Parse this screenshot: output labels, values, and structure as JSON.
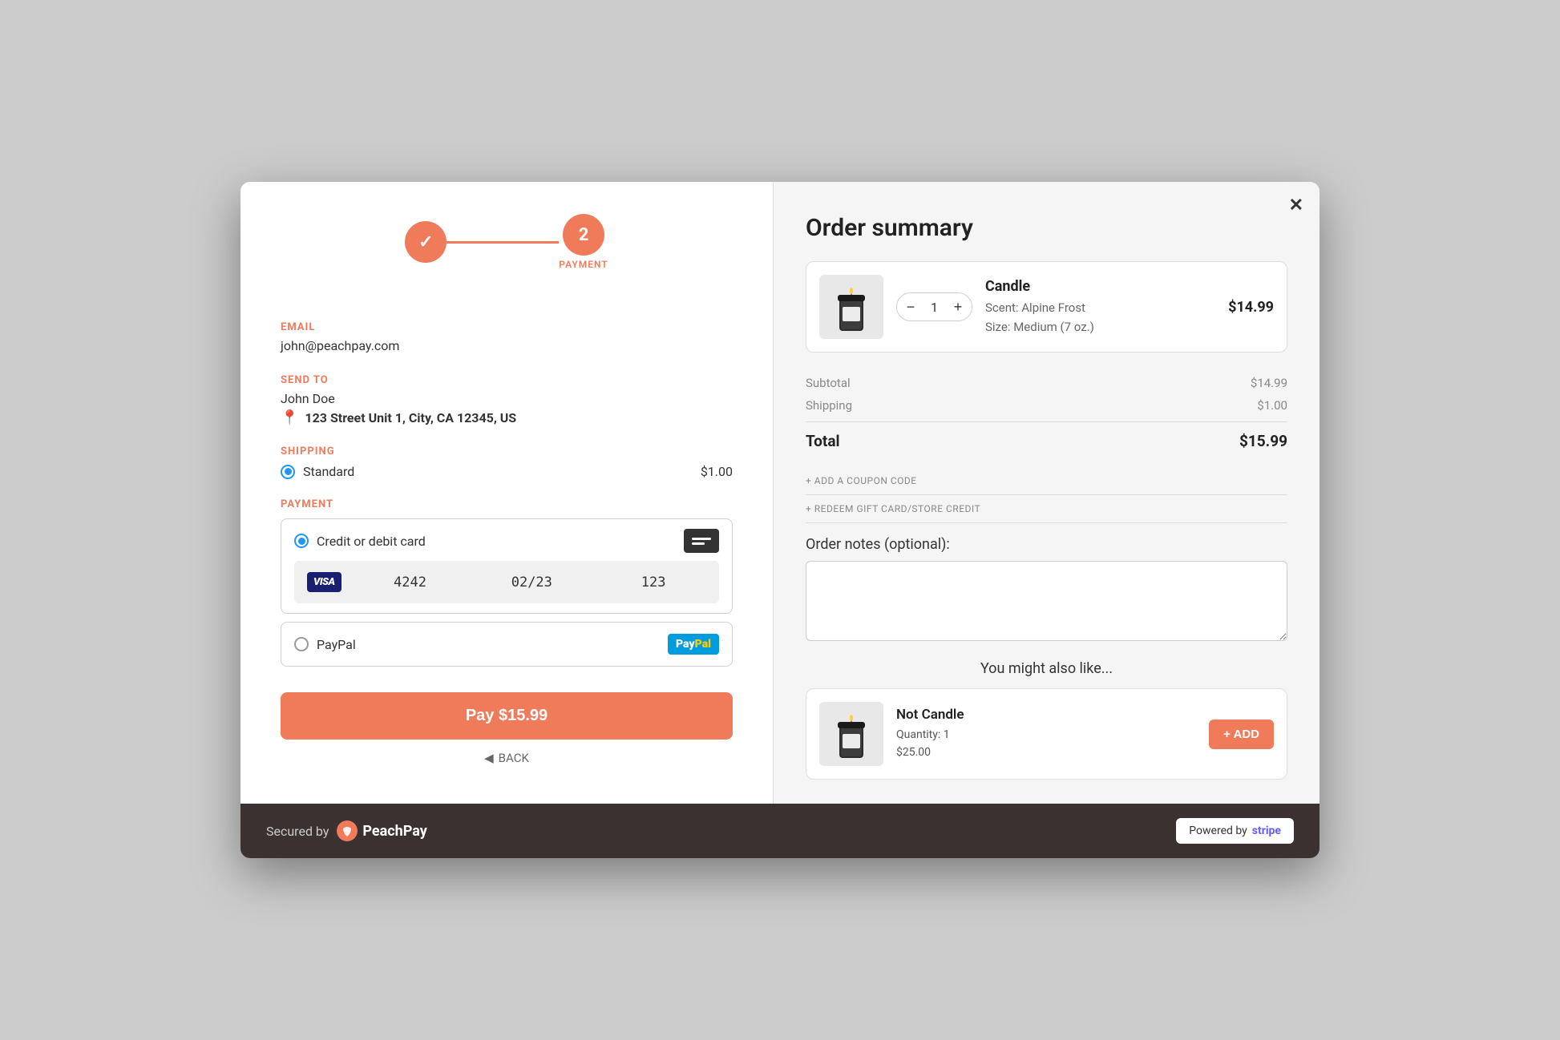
{
  "modal": {
    "close_label": "✕"
  },
  "stepper": {
    "step1_check": "✓",
    "step2_number": "2",
    "step2_label": "PAYMENT"
  },
  "email_section": {
    "label": "EMAIL",
    "value": "john@peachpay.com"
  },
  "send_to_section": {
    "label": "SEND TO",
    "name": "John Doe",
    "address": "123 Street Unit 1, City, CA 12345, US"
  },
  "shipping_section": {
    "label": "SHIPPING",
    "option": "Standard",
    "price": "$1.00"
  },
  "payment_section": {
    "label": "PAYMENT",
    "credit_label": "Credit or debit card",
    "card_number": "4242",
    "card_expiry": "02/23",
    "card_cvv": "123",
    "paypal_label": "PayPal"
  },
  "pay_button": {
    "label": "Pay $15.99"
  },
  "back_link": {
    "label": "BACK"
  },
  "order_summary": {
    "title": "Order summary",
    "product": {
      "name": "Candle",
      "scent": "Alpine Frost",
      "size": "Medium (7 oz.)",
      "quantity": "1",
      "price": "$14.99"
    },
    "subtotal_label": "Subtotal",
    "subtotal_value": "$14.99",
    "shipping_label": "Shipping",
    "shipping_value": "$1.00",
    "total_label": "Total",
    "total_value": "$15.99",
    "coupon_link": "+ ADD A COUPON CODE",
    "gift_link": "+ REDEEM GIFT CARD/STORE CREDIT",
    "notes_label": "Order notes (optional):",
    "notes_placeholder": "",
    "upsell_title": "You might also like...",
    "upsell": {
      "name": "Not Candle",
      "quantity": "Quantity: 1",
      "price": "$25.00",
      "add_label": "+ ADD"
    }
  },
  "footer": {
    "secured_text": "Secured by",
    "peachpay_name": "PeachPay",
    "powered_text": "Powered by",
    "stripe_text": "stripe"
  }
}
